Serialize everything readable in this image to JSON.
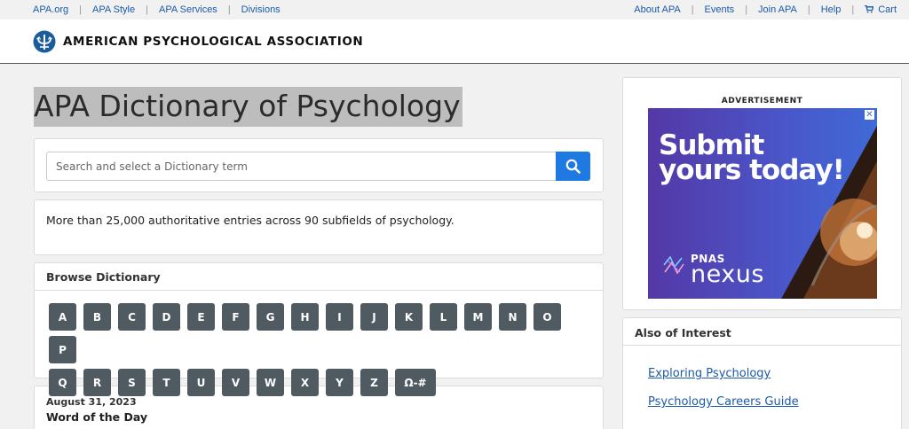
{
  "topbar": {
    "left": [
      "APA.org",
      "APA Style",
      "APA Services",
      "Divisions"
    ],
    "right": [
      "About APA",
      "Events",
      "Join APA",
      "Help",
      "Cart"
    ]
  },
  "header": {
    "logo_text": "AMERICAN PSYCHOLOGICAL ASSOCIATION"
  },
  "main": {
    "title": "APA Dictionary of Psychology",
    "search": {
      "placeholder": "Search and select a Dictionary term",
      "value": ""
    },
    "intro": "More than 25,000 authoritative entries across 90 subfields of psychology.",
    "browse": {
      "heading": "Browse Dictionary",
      "letters": [
        "A",
        "B",
        "C",
        "D",
        "E",
        "F",
        "G",
        "H",
        "I",
        "J",
        "K",
        "L",
        "M",
        "N",
        "O",
        "P",
        "Q",
        "R",
        "S",
        "T",
        "U",
        "V",
        "W",
        "X",
        "Y",
        "Z",
        "Ω-#"
      ]
    },
    "word_of_day": {
      "date": "August 31, 2023",
      "heading": "Word of the Day"
    }
  },
  "aside": {
    "ad": {
      "label": "ADVERTISEMENT",
      "headline_line1": "Submit",
      "headline_line2": "yours today!",
      "brand_top": "PNAS",
      "brand_bottom": "nexus",
      "close": "✕"
    },
    "interest": {
      "heading": "Also of Interest",
      "links": [
        "Exploring Psychology",
        "Psychology Careers Guide"
      ]
    }
  },
  "colors": {
    "link": "#1a5aa8",
    "search_button": "#1e7ae0",
    "letter_button": "#4f5a61"
  }
}
